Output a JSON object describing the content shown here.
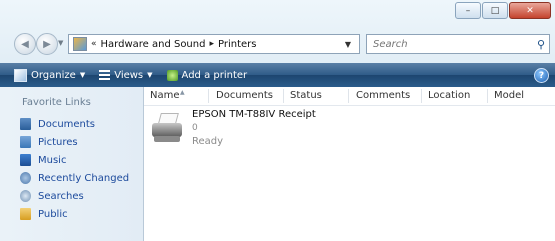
{
  "window": {
    "controls": {
      "minimize": "–",
      "maximize": "□",
      "close": "✕"
    }
  },
  "address_bar": {
    "overflow_marker": "«",
    "separator": "▸",
    "breadcrumbs": [
      "Hardware and Sound",
      "Printers"
    ]
  },
  "search": {
    "placeholder": "Search"
  },
  "toolbar": {
    "organize_label": "Organize",
    "views_label": "Views",
    "add_printer_label": "Add a printer"
  },
  "sidebar": {
    "title": "Favorite Links",
    "items": [
      {
        "label": "Documents",
        "icon": "documents-icon"
      },
      {
        "label": "Pictures",
        "icon": "pictures-icon"
      },
      {
        "label": "Music",
        "icon": "music-icon"
      },
      {
        "label": "Recently Changed",
        "icon": "recently-changed-icon"
      },
      {
        "label": "Searches",
        "icon": "searches-icon"
      },
      {
        "label": "Public",
        "icon": "public-folder-icon"
      }
    ]
  },
  "columns": [
    "Name",
    "Documents",
    "Status",
    "Comments",
    "Location",
    "Model"
  ],
  "printers": [
    {
      "name": "EPSON TM-T88IV Receipt",
      "documents": "0",
      "status": "Ready"
    }
  ],
  "colors": {
    "toolbar": "#2f5b88",
    "link": "#1c4a9c",
    "close_button": "#c4432d"
  }
}
